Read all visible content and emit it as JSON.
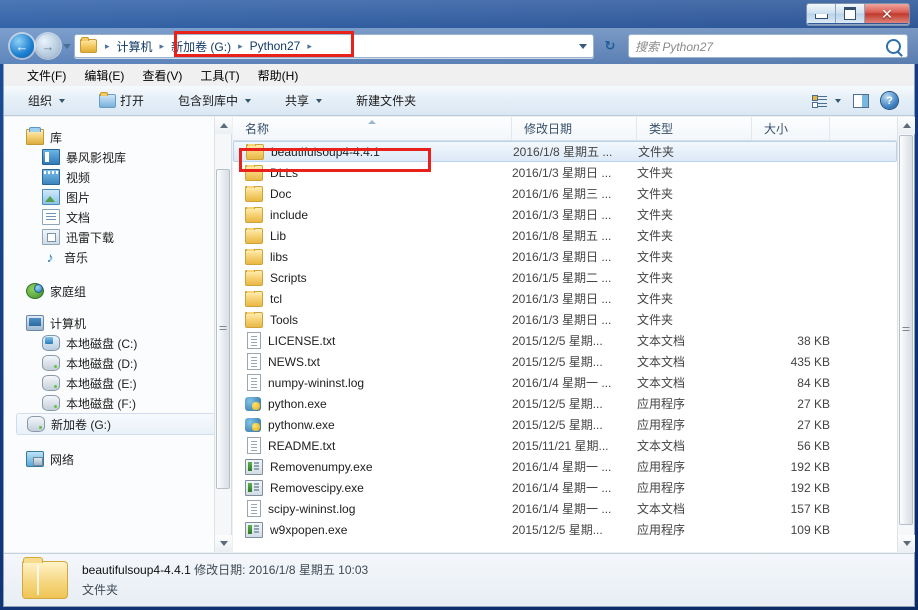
{
  "window": {
    "controls": {
      "minimize": "—",
      "maximize": "□",
      "close": "✕"
    }
  },
  "address": {
    "back_label": "◀",
    "forward_label": "▶",
    "crumbs": [
      "计算机",
      "新加卷 (G:)",
      "Python27"
    ],
    "separator": "▸",
    "refresh_label": "↻"
  },
  "search": {
    "placeholder": "搜索 Python27",
    "icon": "search-icon"
  },
  "menubar": {
    "items": [
      "文件(F)",
      "编辑(E)",
      "查看(V)",
      "工具(T)",
      "帮助(H)"
    ]
  },
  "toolbar": {
    "organize": "组织",
    "open": "打开",
    "include_in_library": "包含到库中",
    "share": "共享",
    "new_folder": "新建文件夹",
    "view_icon": "view-options-icon",
    "preview_icon": "preview-pane-icon",
    "help_icon": "help-icon"
  },
  "navpane": {
    "libraries": {
      "label": "库",
      "children": [
        "暴风影视库",
        "视频",
        "图片",
        "文档",
        "迅雷下载",
        "音乐"
      ]
    },
    "homegroup": "家庭组",
    "computer": {
      "label": "计算机",
      "children": [
        "本地磁盘 (C:)",
        "本地磁盘 (D:)",
        "本地磁盘 (E:)",
        "本地磁盘 (F:)",
        "新加卷 (G:)"
      ],
      "selected": "新加卷 (G:)"
    },
    "network": "网络"
  },
  "filelist": {
    "columns": [
      "名称",
      "修改日期",
      "类型",
      "大小"
    ],
    "sorted_column": "名称",
    "rows": [
      {
        "name": "beautifulsoup4-4.4.1",
        "date": "2016/1/8 星期五 ...",
        "type": "文件夹",
        "size": "",
        "icon": "folder-icon",
        "selected": true
      },
      {
        "name": "DLLs",
        "date": "2016/1/3 星期日 ...",
        "type": "文件夹",
        "size": "",
        "icon": "folder-icon",
        "selected": false
      },
      {
        "name": "Doc",
        "date": "2016/1/6 星期三 ...",
        "type": "文件夹",
        "size": "",
        "icon": "folder-icon",
        "selected": false
      },
      {
        "name": "include",
        "date": "2016/1/3 星期日 ...",
        "type": "文件夹",
        "size": "",
        "icon": "folder-icon",
        "selected": false
      },
      {
        "name": "Lib",
        "date": "2016/1/8 星期五 ...",
        "type": "文件夹",
        "size": "",
        "icon": "folder-icon",
        "selected": false
      },
      {
        "name": "libs",
        "date": "2016/1/3 星期日 ...",
        "type": "文件夹",
        "size": "",
        "icon": "folder-icon",
        "selected": false
      },
      {
        "name": "Scripts",
        "date": "2016/1/5 星期二 ...",
        "type": "文件夹",
        "size": "",
        "icon": "folder-icon",
        "selected": false
      },
      {
        "name": "tcl",
        "date": "2016/1/3 星期日 ...",
        "type": "文件夹",
        "size": "",
        "icon": "folder-icon",
        "selected": false
      },
      {
        "name": "Tools",
        "date": "2016/1/3 星期日 ...",
        "type": "文件夹",
        "size": "",
        "icon": "folder-icon",
        "selected": false
      },
      {
        "name": "LICENSE.txt",
        "date": "2015/12/5 星期...",
        "type": "文本文档",
        "size": "38 KB",
        "icon": "text-file-icon",
        "selected": false
      },
      {
        "name": "NEWS.txt",
        "date": "2015/12/5 星期...",
        "type": "文本文档",
        "size": "435 KB",
        "icon": "text-file-icon",
        "selected": false
      },
      {
        "name": "numpy-wininst.log",
        "date": "2016/1/4 星期一 ...",
        "type": "文本文档",
        "size": "84 KB",
        "icon": "text-file-icon",
        "selected": false
      },
      {
        "name": "python.exe",
        "date": "2015/12/5 星期...",
        "type": "应用程序",
        "size": "27 KB",
        "icon": "python-icon",
        "selected": false
      },
      {
        "name": "pythonw.exe",
        "date": "2015/12/5 星期...",
        "type": "应用程序",
        "size": "27 KB",
        "icon": "python-icon",
        "selected": false
      },
      {
        "name": "README.txt",
        "date": "2015/11/21 星期...",
        "type": "文本文档",
        "size": "56 KB",
        "icon": "text-file-icon",
        "selected": false
      },
      {
        "name": "Removenumpy.exe",
        "date": "2016/1/4 星期一 ...",
        "type": "应用程序",
        "size": "192 KB",
        "icon": "exe-icon",
        "selected": false
      },
      {
        "name": "Removescipy.exe",
        "date": "2016/1/4 星期一 ...",
        "type": "应用程序",
        "size": "192 KB",
        "icon": "exe-icon",
        "selected": false
      },
      {
        "name": "scipy-wininst.log",
        "date": "2016/1/4 星期一 ...",
        "type": "文本文档",
        "size": "157 KB",
        "icon": "text-file-icon",
        "selected": false
      },
      {
        "name": "w9xpopen.exe",
        "date": "2015/12/5 星期...",
        "type": "应用程序",
        "size": "109 KB",
        "icon": "exe-icon",
        "selected": false
      }
    ]
  },
  "details": {
    "name": "beautifulsoup4-4.4.1",
    "modified_label": "修改日期:",
    "modified_value": "2016/1/8 星期五 10:03",
    "type": "文件夹"
  },
  "colors": {
    "annotation": "#e8211a",
    "selection": "#dce9f7",
    "desktop": "#143f86"
  }
}
